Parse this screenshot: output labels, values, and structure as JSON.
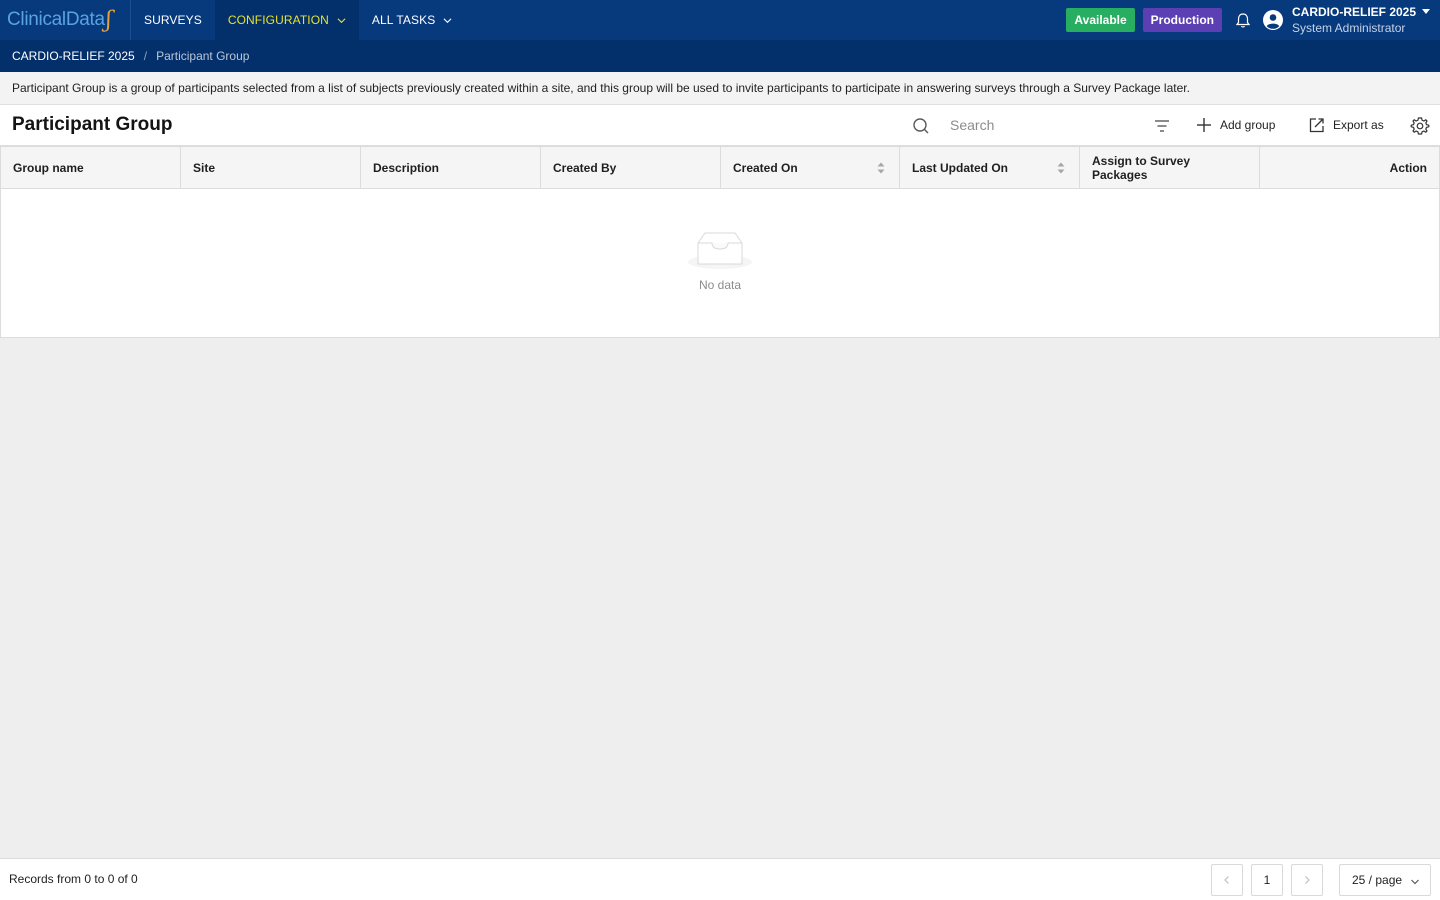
{
  "nav": {
    "logo_text": "ClinicalData",
    "items": [
      {
        "label": "SURVEYS",
        "active": false,
        "dropdown": false
      },
      {
        "label": "CONFIGURATION",
        "active": true,
        "dropdown": true
      },
      {
        "label": "ALL TASKS",
        "active": false,
        "dropdown": true
      }
    ],
    "status_badge": "Available",
    "env_badge": "Production",
    "bell_icon": "bell-icon",
    "user_icon": "user-circle-icon",
    "user": {
      "study": "CARDIO-RELIEF 2025",
      "role": "System Administrator"
    }
  },
  "breadcrumb": {
    "root": "CARDIO-RELIEF 2025",
    "separator": "/",
    "current": "Participant Group"
  },
  "description": "Participant Group is a group of participants selected from a list of subjects previously created within a site, and this group will be used to invite participants to participate in answering surveys through a Survey Package later.",
  "toolbar": {
    "title": "Participant Group",
    "search_placeholder": "Search",
    "add_label": "Add group",
    "export_label": "Export as"
  },
  "table": {
    "columns": [
      {
        "label": "Group name",
        "sortable": false
      },
      {
        "label": "Site",
        "sortable": false
      },
      {
        "label": "Description",
        "sortable": false
      },
      {
        "label": "Created By",
        "sortable": false
      },
      {
        "label": "Created On",
        "sortable": true
      },
      {
        "label": "Last Updated On",
        "sortable": true
      },
      {
        "label": "Assign to Survey Packages",
        "sortable": false
      },
      {
        "label": "Action",
        "sortable": false
      }
    ],
    "rows": [],
    "empty_text": "No data"
  },
  "footer": {
    "records_text": "Records from 0 to 0 of 0",
    "current_page": "1",
    "page_size": "25 / page"
  },
  "colors": {
    "nav_bg": "#073a7d",
    "breadcrumb_bg": "#03306a",
    "active_nav_text": "#e6e22b",
    "available": "#27ae60",
    "production": "#5b3fb3"
  }
}
